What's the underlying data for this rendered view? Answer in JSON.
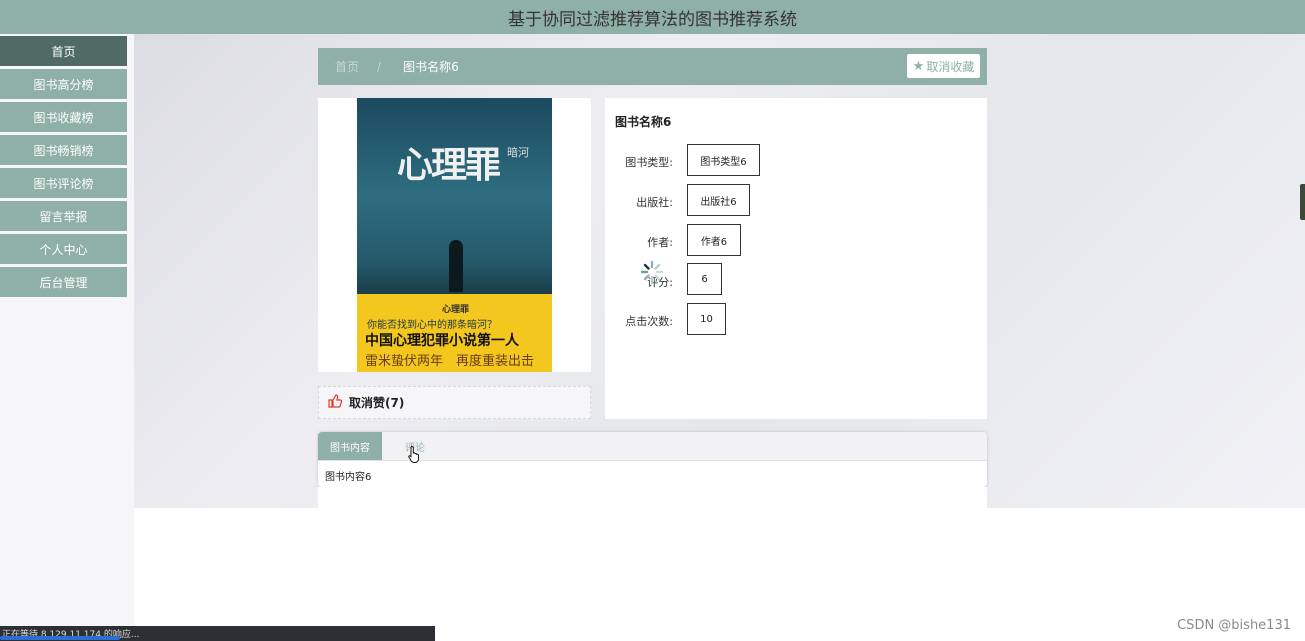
{
  "header": {
    "title": "基于协同过滤推荐算法的图书推荐系统"
  },
  "sidebar": {
    "items": [
      {
        "label": "首页"
      },
      {
        "label": "图书高分榜"
      },
      {
        "label": "图书收藏榜"
      },
      {
        "label": "图书畅销榜"
      },
      {
        "label": "图书评论榜"
      },
      {
        "label": "留言举报"
      },
      {
        "label": "个人中心"
      },
      {
        "label": "后台管理"
      }
    ]
  },
  "breadcrumb": {
    "home": "首页",
    "separator": "/",
    "current": "图书名称6"
  },
  "favorite_button": {
    "icon": "star-icon",
    "label": "取消收藏"
  },
  "cover": {
    "title": "心理罪",
    "side_text": "暗河",
    "tagline_small": "你能否找到心中的那条暗河？",
    "tagline_big": "中国心理犯罪小说第一人",
    "tagline_sub": "雷米蛰伏两年　再度重装出击",
    "publisher_mark": "心理罪"
  },
  "like": {
    "icon": "thumbs-up-icon",
    "label": "取消赞(7)"
  },
  "details": {
    "title": "图书名称6",
    "fields": [
      {
        "label": "图书类型:",
        "value": "图书类型6"
      },
      {
        "label": "出版社:",
        "value": "出版社6"
      },
      {
        "label": "作者:",
        "value": "作者6"
      },
      {
        "label": "评分:",
        "value": "6"
      },
      {
        "label": "点击次数:",
        "value": "10"
      }
    ]
  },
  "tabs": {
    "items": [
      {
        "label": "图书内容"
      },
      {
        "label": "评论"
      }
    ],
    "content": "图书内容6"
  },
  "status_bar": {
    "text": "正在等待 8.129.11.174 的响应..."
  },
  "watermark": "CSDN @bishe131",
  "colors": {
    "accent": "#8fb0a6",
    "active_nav": "#4f6b64",
    "like": "#e0362b"
  }
}
